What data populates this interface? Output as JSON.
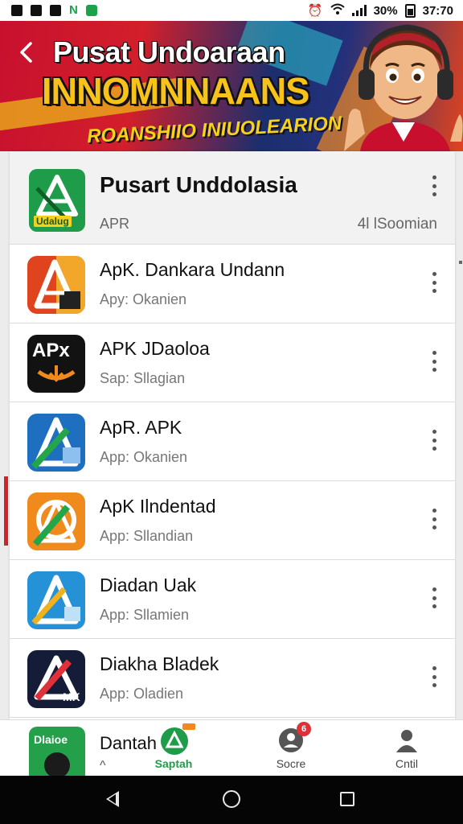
{
  "status_bar": {
    "battery": "30%",
    "time": "37:70"
  },
  "banner": {
    "title": "Pusat Undoaraan",
    "headline": "INNOMNNAANS",
    "tagline": "ROANSHIIO INIUOLEARION"
  },
  "featured": {
    "title": "Pusart Unddolasia",
    "icon_text": "Udalug",
    "subtitle": "APR",
    "meta": "4l lSoomian"
  },
  "apps": [
    {
      "title": "ApK. Dankara Undann",
      "subtitle": "Apy: Okanien",
      "icon_text": "A",
      "icon_color": "#e0441f"
    },
    {
      "title": "APK JDaoloa",
      "subtitle": "Sap: Sllagian",
      "icon_text": "APx",
      "icon_color": "#121212"
    },
    {
      "title": "ApR. APK",
      "subtitle": "App: Okanien",
      "icon_text": "A",
      "icon_color": "#1f6fc0"
    },
    {
      "title": "ApK Ilndentad",
      "subtitle": "App: Sllandian",
      "icon_text": "A",
      "icon_color": "#f08a1c"
    },
    {
      "title": "Diadan Uak",
      "subtitle": "App: Sllamien",
      "icon_text": "A",
      "icon_color": "#2592d8"
    },
    {
      "title": "Diakha Bladek",
      "subtitle": "App: Oladien",
      "icon_text": "MK",
      "icon_color": "#141c38"
    }
  ],
  "bottom_peek": {
    "title": "Dantah",
    "subtitle": "^",
    "icon_text": "Dlaioe"
  },
  "nav": {
    "items": [
      {
        "label": "Saptah"
      },
      {
        "label": "Socre",
        "badge": "6"
      },
      {
        "label": "Cntil"
      }
    ]
  },
  "colors": {
    "accent": "#1f9c4a",
    "banner_red": "#c8102e",
    "banner_yellow": "#f7c21a"
  }
}
